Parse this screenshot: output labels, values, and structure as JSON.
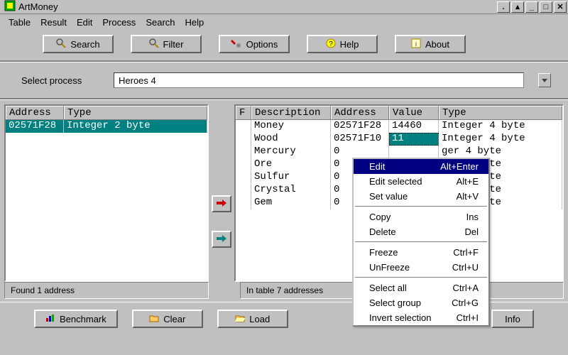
{
  "window": {
    "title": "ArtMoney"
  },
  "menu": {
    "items": [
      "Table",
      "Result",
      "Edit",
      "Process",
      "Search",
      "Help"
    ]
  },
  "toolbar": {
    "search": "Search",
    "filter": "Filter",
    "options": "Options",
    "help": "Help",
    "about": "About"
  },
  "process_row": {
    "label": "Select process",
    "value": "Heroes 4"
  },
  "left_grid": {
    "cols": {
      "address": "Address",
      "type": "Type"
    },
    "rows": [
      {
        "address": "02571F28",
        "type": "Integer 2 byte"
      }
    ]
  },
  "right_grid": {
    "cols": {
      "f": "F",
      "desc": "Description",
      "address": "Address",
      "value": "Value",
      "type": "Type"
    },
    "rows": [
      {
        "f": "",
        "desc": "Money",
        "address": "02571F28",
        "value": "14460",
        "type": "Integer 4 byte"
      },
      {
        "f": "",
        "desc": "Wood",
        "address": "02571F10",
        "value": "11",
        "type": "Integer 4 byte"
      },
      {
        "f": "",
        "desc": "Mercury",
        "address": "0",
        "value": "",
        "type": "ger 4 byte"
      },
      {
        "f": "",
        "desc": "Ore",
        "address": "0",
        "value": "",
        "type": "ger 4 byte"
      },
      {
        "f": "",
        "desc": "Sulfur",
        "address": "0",
        "value": "",
        "type": "ger 4 byte"
      },
      {
        "f": "",
        "desc": "Crystal",
        "address": "0",
        "value": "",
        "type": "ger 4 byte"
      },
      {
        "f": "",
        "desc": "Gem",
        "address": "0",
        "value": "",
        "type": "ger 4 byte"
      }
    ]
  },
  "status": {
    "left": "Found 1 address",
    "right": "In table 7 addresses"
  },
  "bottom": {
    "benchmark": "Benchmark",
    "clear": "Clear",
    "load": "Load",
    "info": "Info"
  },
  "context_menu": {
    "edit": {
      "label": "Edit",
      "shortcut": "Alt+Enter"
    },
    "edit_selected": {
      "label": "Edit selected",
      "shortcut": "Alt+E"
    },
    "set_value": {
      "label": "Set value",
      "shortcut": "Alt+V"
    },
    "copy": {
      "label": "Copy",
      "shortcut": "Ins"
    },
    "delete": {
      "label": "Delete",
      "shortcut": "Del"
    },
    "freeze": {
      "label": "Freeze",
      "shortcut": "Ctrl+F"
    },
    "unfreeze": {
      "label": "UnFreeze",
      "shortcut": "Ctrl+U"
    },
    "select_all": {
      "label": "Select all",
      "shortcut": "Ctrl+A"
    },
    "select_group": {
      "label": "Select group",
      "shortcut": "Ctrl+G"
    },
    "invert_selection": {
      "label": "Invert selection",
      "shortcut": "Ctrl+I"
    }
  },
  "icons": {
    "app": "app-icon",
    "search": "magnifier-icon",
    "filter": "magnifier-icon",
    "options": "wrench-icon",
    "help": "question-icon",
    "about": "about-icon",
    "benchmark": "chart-icon",
    "clear": "folder-icon",
    "load": "folder-open-icon",
    "info": "info-icon",
    "arrow_red": "arrow-right-red-icon",
    "arrow_teal": "arrow-right-teal-icon"
  }
}
